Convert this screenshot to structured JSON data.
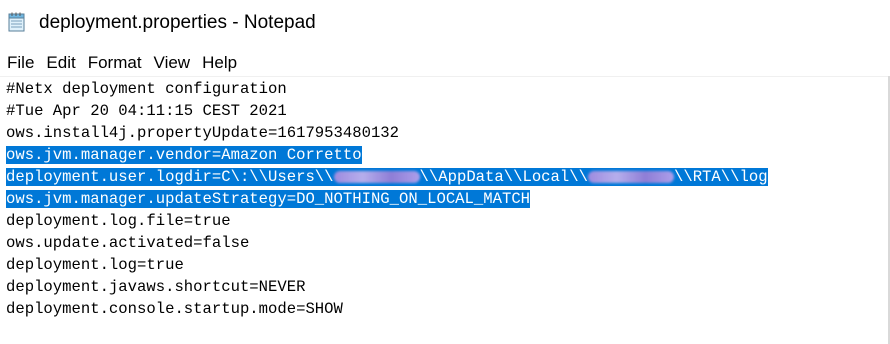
{
  "window": {
    "title": "deployment.properties - Notepad",
    "icon": "notepad-icon"
  },
  "menu": {
    "items": [
      "File",
      "Edit",
      "Format",
      "View",
      "Help"
    ]
  },
  "editor": {
    "selection_color": "#0078d7",
    "lines": [
      "#Netx deployment configuration",
      "#Tue Apr 20 04:11:15 CEST 2021",
      "ows.install4j.propertyUpdate=1617953480132",
      "ows.jvm.manager.vendor=Amazon Corretto",
      "deployment.user.logdir=C\\:\\\\Users\\\\",
      "\\\\AppData\\\\Local\\\\",
      "\\\\RTA\\\\log",
      "ows.jvm.manager.updateStrategy=DO_NOTHING_ON_LOCAL_MATCH",
      "deployment.log.file=true",
      "ows.update.activated=false",
      "deployment.log=true",
      "deployment.javaws.shortcut=NEVER",
      "deployment.console.startup.mode=SHOW"
    ]
  }
}
